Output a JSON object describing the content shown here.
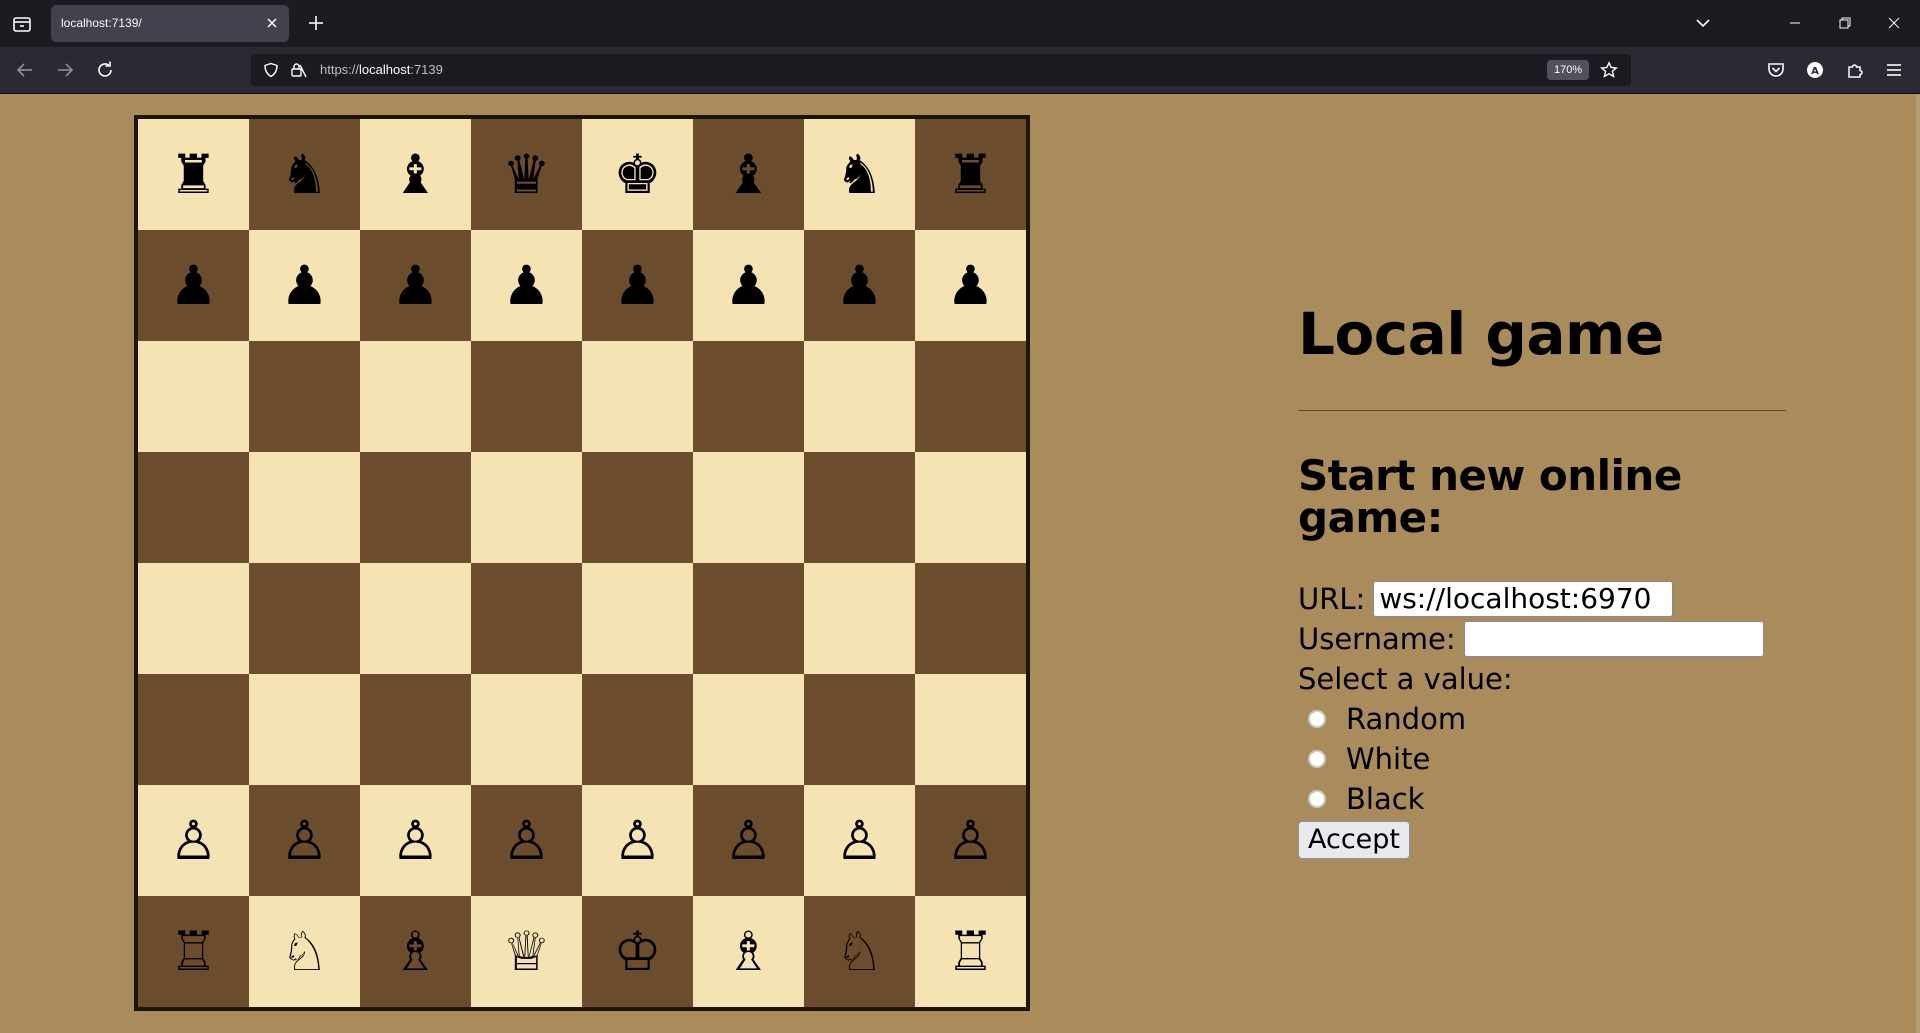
{
  "browser": {
    "tab_title": "localhost:7139/",
    "url_scheme": "https://",
    "url_host": "localhost",
    "url_port": ":7139",
    "zoom": "170%"
  },
  "board": {
    "light_color": "#f5e3b3",
    "dark_color": "#6b4c2d",
    "ranks": [
      [
        "♜",
        "♞",
        "♝",
        "♛",
        "♚",
        "♝",
        "♞",
        "♜"
      ],
      [
        "♟",
        "♟",
        "♟",
        "♟",
        "♟",
        "♟",
        "♟",
        "♟"
      ],
      [
        "",
        "",
        "",
        "",
        "",
        "",
        "",
        ""
      ],
      [
        "",
        "",
        "",
        "",
        "",
        "",
        "",
        ""
      ],
      [
        "",
        "",
        "",
        "",
        "",
        "",
        "",
        ""
      ],
      [
        "",
        "",
        "",
        "",
        "",
        "",
        "",
        ""
      ],
      [
        "♙",
        "♙",
        "♙",
        "♙",
        "♙",
        "♙",
        "♙",
        "♙"
      ],
      [
        "♖",
        "♘",
        "♗",
        "♕",
        "♔",
        "♗",
        "♘",
        "♖"
      ]
    ]
  },
  "panel": {
    "title": "Local game",
    "subtitle": "Start new online game:",
    "url_label": "URL:",
    "url_value": "ws://localhost:6970",
    "username_label": "Username:",
    "username_value": "",
    "select_label": "Select a value:",
    "options": [
      "Random",
      "White",
      "Black"
    ],
    "accept_label": "Accept"
  }
}
